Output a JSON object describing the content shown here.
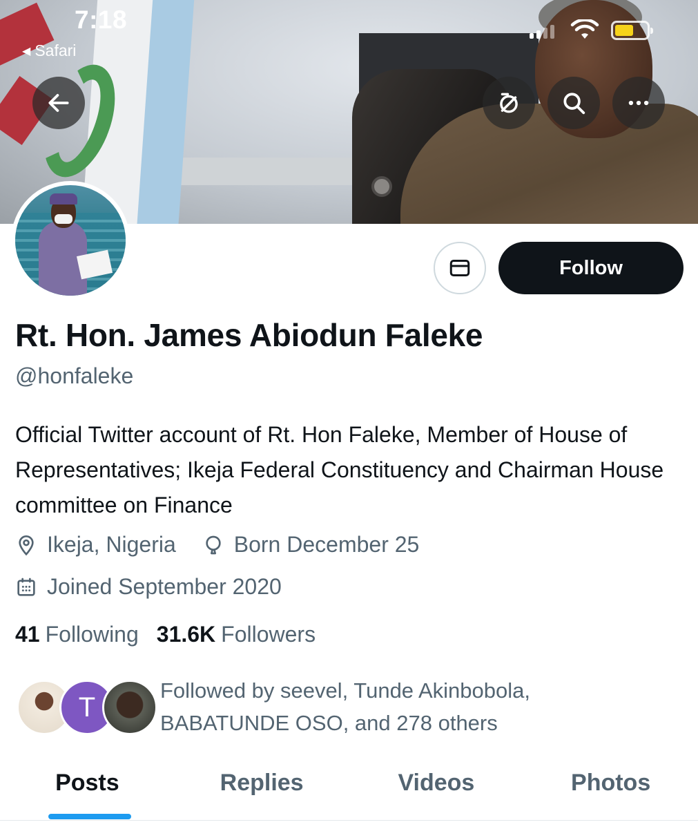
{
  "status_bar": {
    "time": "7:18",
    "back_app": "Safari"
  },
  "header": {
    "buttons": [
      "back-arrow-icon",
      "hide-replies-icon",
      "search-icon",
      "more-icon"
    ]
  },
  "profile": {
    "name": "Rt. Hon. James Abiodun Faleke",
    "handle": "@honfaleke",
    "bio": "Official Twitter account of Rt. Hon Faleke, Member of House of Representatives; Ikeja Federal Constituency and Chairman House committee on Finance",
    "location": "Ikeja, Nigeria",
    "birthday": "Born December 25",
    "joined": "Joined September 2020",
    "following_count": "41",
    "following_label": "Following",
    "followers_count": "31.6K",
    "followers_label": "Followers",
    "followed_by": "Followed by seevel, Tunde Akinbobola, BABATUNDE OSO, and 278 others",
    "follower_avatar_initial": "T"
  },
  "actions": {
    "follow_label": "Follow",
    "message_icon": "envelope-icon"
  },
  "tabs": [
    "Posts",
    "Replies",
    "Videos",
    "Photos"
  ],
  "active_tab": "Posts",
  "colors": {
    "accent": "#1d9bf0",
    "text_primary": "#0f1419",
    "text_secondary": "#536471",
    "follow_button": "#0f1419"
  }
}
